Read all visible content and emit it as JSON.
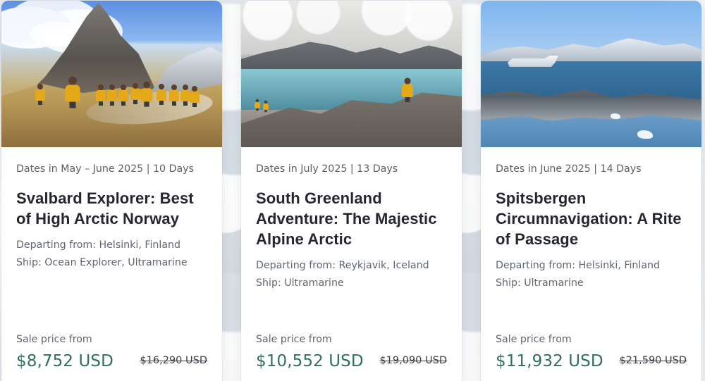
{
  "cards": [
    {
      "dates": "Dates in May – June 2025 | 10 Days",
      "title": "Svalbard Explorer: Best of High Arctic Norway",
      "departing": "Departing from: Helsinki, Finland",
      "ship": "Ship: Ocean Explorer, Ultramarine",
      "sale_label": "Sale price from",
      "sale_price": "$8,752 USD",
      "original_price": "$16,290 USD"
    },
    {
      "dates": "Dates in July 2025 | 13 Days",
      "title": "South Greenland Adventure: The Majestic Alpine Arctic",
      "departing": "Departing from: Reykjavik, Iceland",
      "ship": "Ship: Ultramarine",
      "sale_label": "Sale price from",
      "sale_price": "$10,552 USD",
      "original_price": "$19,090 USD"
    },
    {
      "dates": "Dates in June 2025 | 14 Days",
      "title": "Spitsbergen Circumnavigation: A Rite of Passage",
      "departing": "Departing from: Helsinki, Finland",
      "ship": "Ship: Ultramarine",
      "sale_label": "Sale price from",
      "sale_price": "$11,932 USD",
      "original_price": "$21,590 USD"
    }
  ]
}
